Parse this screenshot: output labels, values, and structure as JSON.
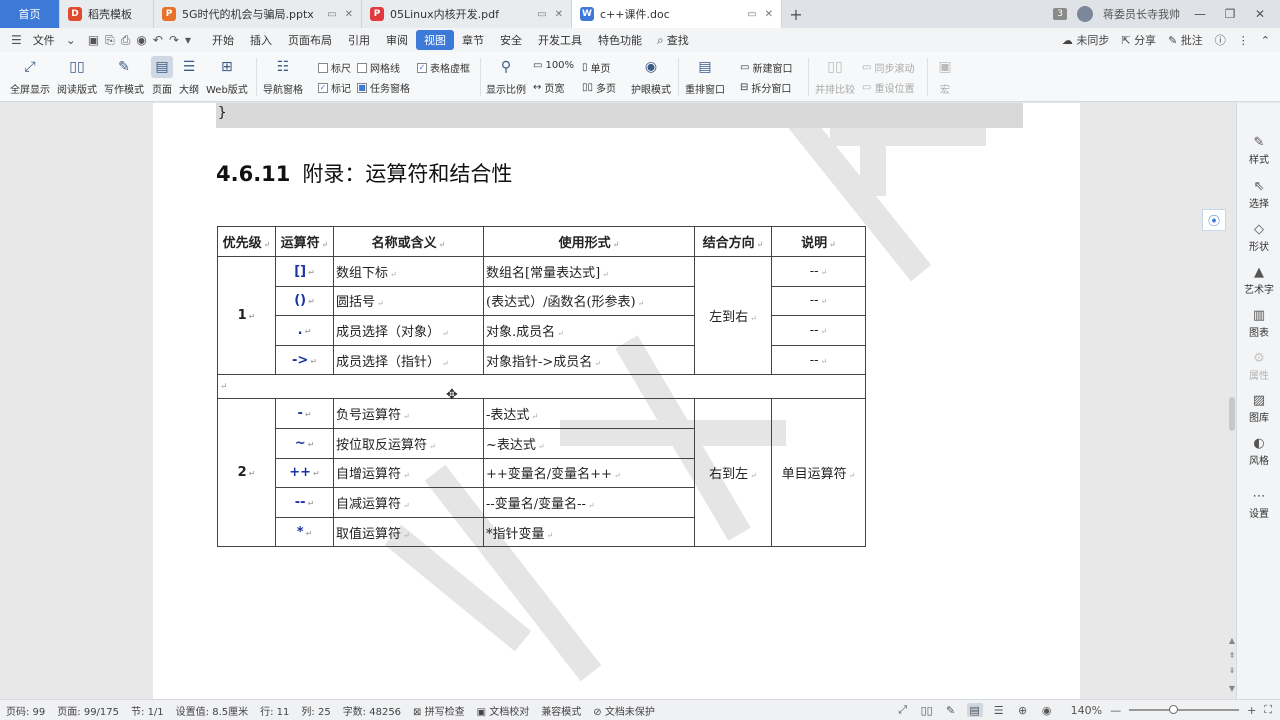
{
  "titlebar": {
    "tabs": [
      {
        "label": "首页",
        "kind": "home"
      },
      {
        "label": "稻壳模板",
        "kind": "normal",
        "icon": "docer-icon",
        "icon_color": "#e04b2b",
        "icon_glyph": "D"
      },
      {
        "label": "5G时代的机会与骗局.pptx",
        "kind": "normal",
        "icon": "pptx-icon",
        "icon_color": "#e8712c",
        "icon_glyph": "P"
      },
      {
        "label": "05Linux内核开发.pdf",
        "kind": "normal",
        "icon": "pdf-icon",
        "icon_color": "#e0393e",
        "icon_glyph": "P"
      },
      {
        "label": "c++课件.doc",
        "kind": "active",
        "icon": "doc-icon",
        "icon_color": "#3d7ad8",
        "icon_glyph": "W"
      }
    ],
    "new_tab": "+",
    "window_count": "3",
    "user_name": "蒋委员长寺我帅",
    "window_controls": [
      "—",
      "❐",
      "✕"
    ]
  },
  "menubar": {
    "file_label": "文件",
    "items": [
      "开始",
      "插入",
      "页面布局",
      "引用",
      "审阅",
      "视图",
      "章节",
      "安全",
      "开发工具",
      "特色功能"
    ],
    "active": "视图",
    "search": "查找",
    "right": {
      "sync": "未同步",
      "share": "分享",
      "comment": "批注"
    }
  },
  "ribbon": {
    "views": [
      {
        "label": "全屏显示",
        "icon": "fullscreen-icon"
      },
      {
        "label": "阅读版式",
        "icon": "reading-icon"
      },
      {
        "label": "写作模式",
        "icon": "pen-icon"
      },
      {
        "label": "页面",
        "icon": "page-icon",
        "selected": true
      },
      {
        "label": "大纲",
        "icon": "outline-icon"
      },
      {
        "label": "Web版式",
        "icon": "web-icon"
      }
    ],
    "nav_pane": "导航窗格",
    "checks": {
      "ruler": "标尺",
      "gridlines": "网格线",
      "table_frame": "表格虚框",
      "marks": "标记",
      "task_pane": "任务窗格"
    },
    "display_ratio": "显示比例",
    "zoom100": "100%",
    "single_page": "单页",
    "page_width": "页宽",
    "multi_page": "多页",
    "eye_mode": "护眼模式",
    "arrange": "重排窗口",
    "new_window": "新建窗口",
    "split_window": "拆分窗口",
    "side_by_side": "并排比较",
    "sync_scroll": "同步滚动",
    "reset_pos": "重设位置",
    "macro": "宏"
  },
  "document": {
    "code_line": "}",
    "heading_num": "4.6.11",
    "heading_text": "附录：运算符和结合性",
    "table_headers": [
      "优先级",
      "运算符",
      "名称或含义",
      "使用形式",
      "结合方向",
      "说明"
    ],
    "group1": {
      "level": "1",
      "assoc": "左到右",
      "rows": [
        {
          "op": "[]",
          "name": "数组下标",
          "usage": "数组名[常量表达式]",
          "note": "--"
        },
        {
          "op": "()",
          "name": "圆括号",
          "usage": "(表达式）/函数名(形参表)",
          "note": "--"
        },
        {
          "op": ".",
          "name": "成员选择（对象）",
          "usage": "对象.成员名",
          "note": "--"
        },
        {
          "op": "->",
          "name": "成员选择（指针）",
          "usage": "对象指针->成员名",
          "note": "--"
        }
      ]
    },
    "group2": {
      "level": "2",
      "assoc": "右到左",
      "note": "单目运算符",
      "rows": [
        {
          "op": "-",
          "name": "负号运算符",
          "usage": "-表达式"
        },
        {
          "op": "~",
          "name": "按位取反运算符",
          "usage": "~表达式"
        },
        {
          "op": "++",
          "name": "自增运算符",
          "usage": "++变量名/变量名++"
        },
        {
          "op": "--",
          "name": "自减运算符",
          "usage": "--变量名/变量名--"
        },
        {
          "op": "*",
          "name": "取值运算符",
          "usage": "*指针变量"
        }
      ]
    },
    "para_mark": "↵",
    "watermark": "千锋教育"
  },
  "sidepanel": [
    {
      "label": "样式",
      "icon": "style-icon"
    },
    {
      "label": "选择",
      "icon": "select-icon"
    },
    {
      "label": "形状",
      "icon": "shape-icon"
    },
    {
      "label": "艺术字",
      "icon": "wordart-icon"
    },
    {
      "label": "图表",
      "icon": "chart-icon"
    },
    {
      "label": "属性",
      "icon": "property-icon",
      "disabled": true
    },
    {
      "label": "图库",
      "icon": "gallery-icon"
    },
    {
      "label": "风格",
      "icon": "theme-icon"
    },
    {
      "label": "设置",
      "icon": "more-icon"
    }
  ],
  "statusbar": {
    "page_code": "页码: 99",
    "page": "页面: 99/175",
    "section": "节: 1/1",
    "setting": "设置值: 8.5厘米",
    "row": "行: 11",
    "col": "列: 25",
    "words": "字数: 48256",
    "spell": "拼写检查",
    "proof": "文档校对",
    "compat": "兼容模式",
    "protect": "文档未保护",
    "zoom": "140%",
    "zoom_fraction": 0.4
  }
}
